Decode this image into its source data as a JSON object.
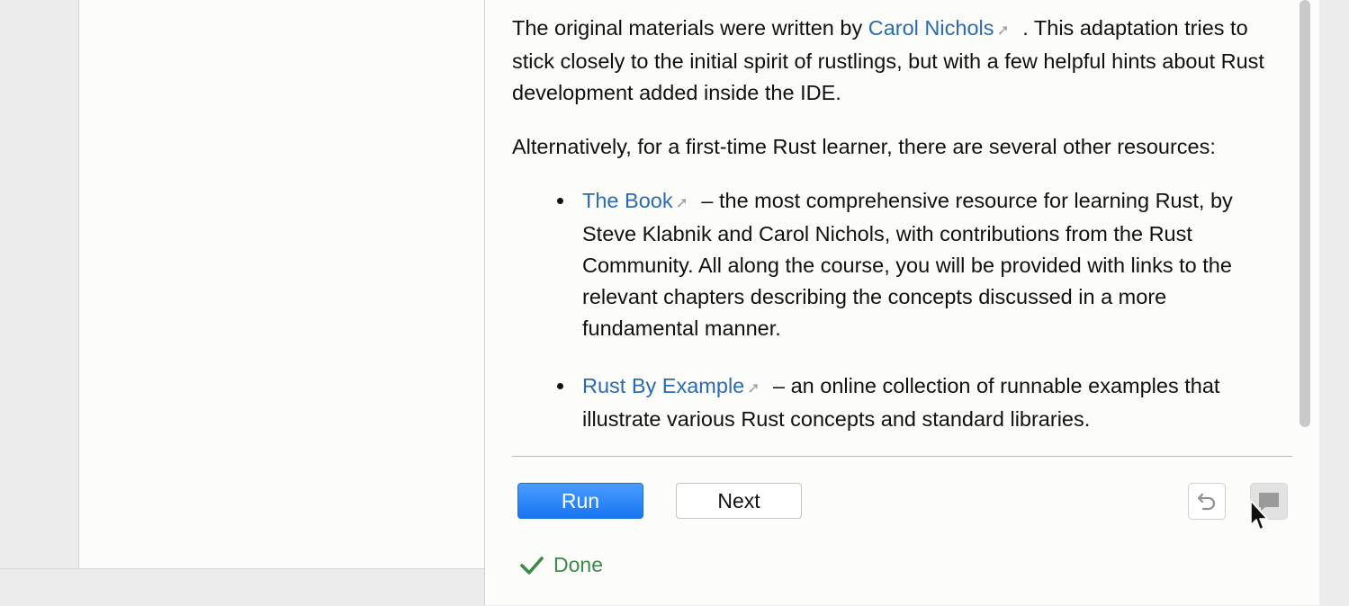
{
  "description": {
    "para1": {
      "before": "The original materials were written by ",
      "link": "Carol Nichols",
      "after": " . This adaptation tries to stick closely to the initial spirit of rustlings, but with a few helpful hints about Rust development added inside the IDE."
    },
    "para2": "Alternatively, for a first-time Rust learner, there are several other resources:",
    "resources": [
      {
        "link": "The Book",
        "text": " – the most comprehensive resource for learning Rust, by Steve Klabnik and Carol Nichols, with contributions from the Rust Community. All along the course, you will be provided with links to the relevant chapters describing the concepts discussed in a more fundamental manner."
      },
      {
        "link": "Rust By Example",
        "text": " – an online collection of runnable examples that illustrate various Rust concepts and standard libraries."
      }
    ],
    "external_link_glyph": "➚"
  },
  "actions": {
    "run_label": "Run",
    "next_label": "Next",
    "reset_icon": "undo-icon",
    "feedback_icon": "comment-icon"
  },
  "status": {
    "text": "Done",
    "icon": "checkmark-icon",
    "color": "#3c8a47"
  },
  "colors": {
    "link": "#2a6bb3",
    "run_button": "#1875f2"
  }
}
